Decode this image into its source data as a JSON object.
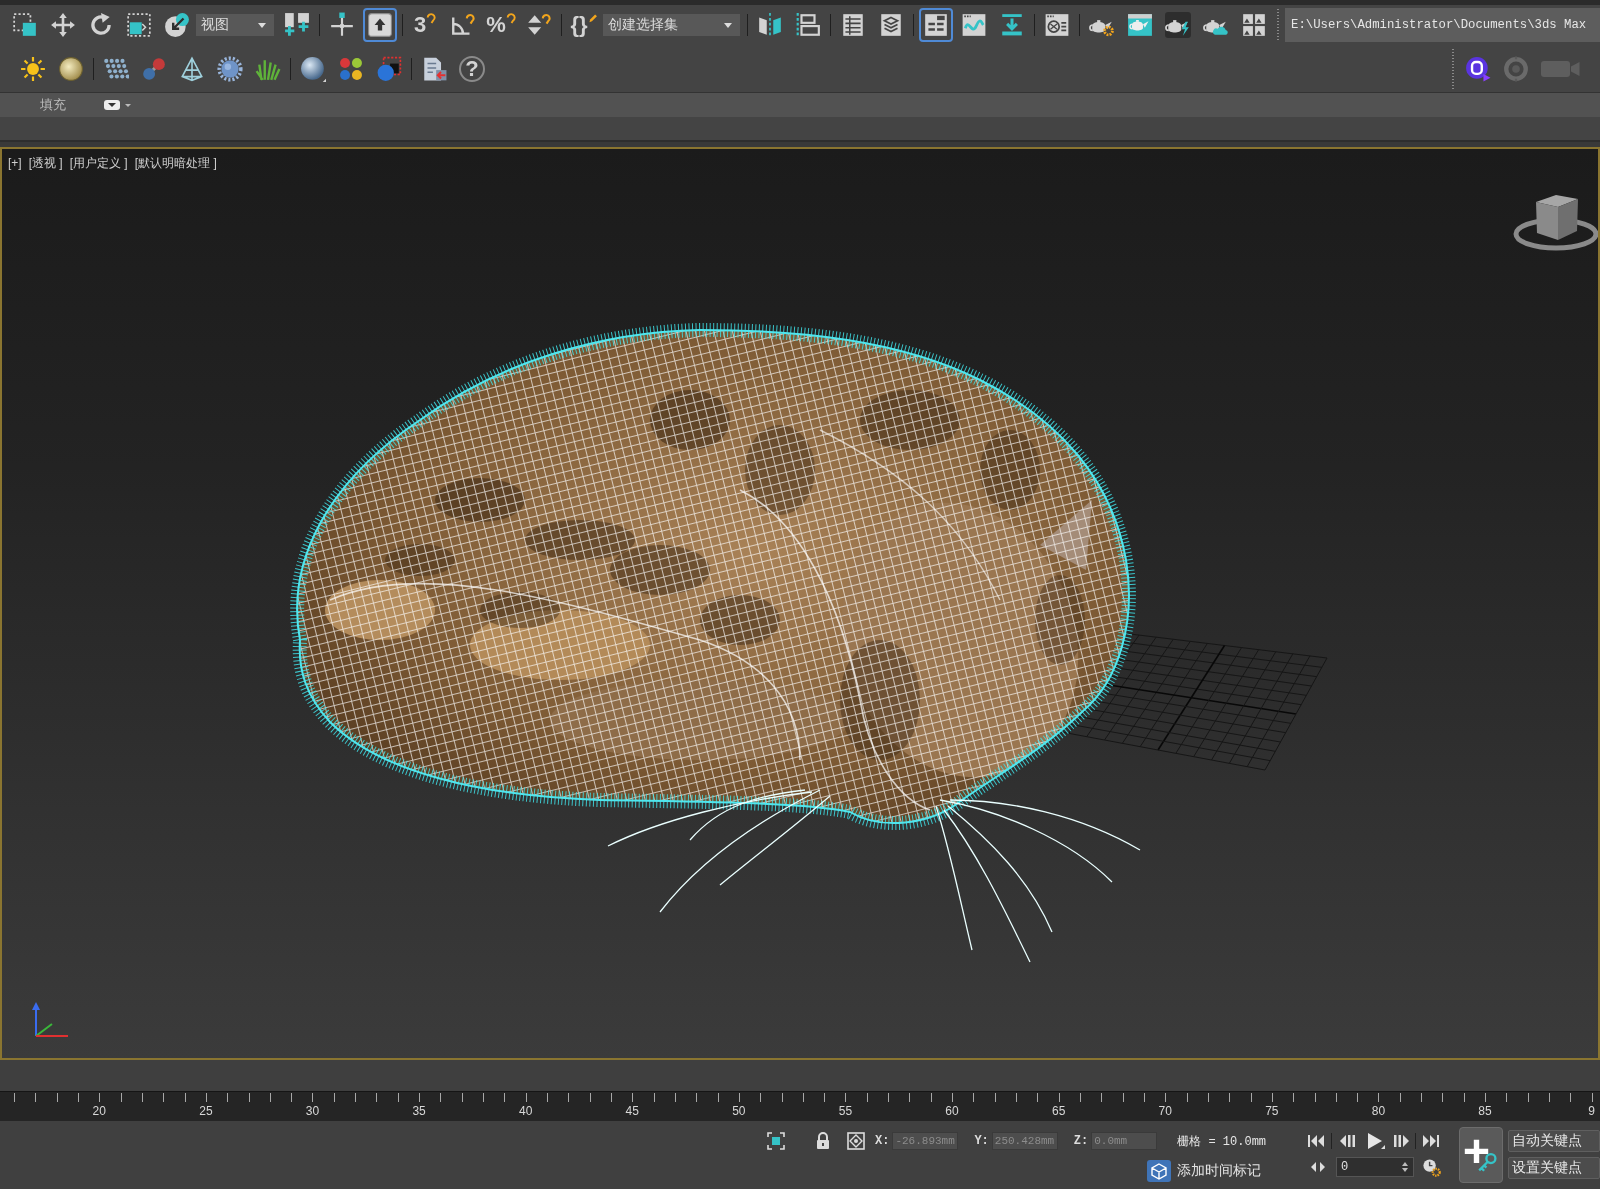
{
  "main_toolbar": {
    "groups": [
      [
        {
          "kind": "button",
          "selected": false
        },
        {
          "kind": "button",
          "selected": false
        },
        {
          "kind": "button",
          "selected": false
        },
        {
          "kind": "button",
          "selected": false
        },
        {
          "kind": "button",
          "selected": false
        },
        {
          "kind": "dropdown",
          "value": "视图"
        },
        {
          "kind": "button",
          "selected": false
        }
      ],
      [
        {
          "kind": "button",
          "selected": false
        },
        {
          "kind": "button",
          "selected": true
        }
      ],
      [
        {
          "kind": "button",
          "selected": false,
          "label": "3"
        },
        {
          "kind": "button",
          "selected": false
        },
        {
          "kind": "button",
          "selected": false,
          "label": "%"
        },
        {
          "kind": "button",
          "selected": false
        }
      ],
      [
        {
          "kind": "button",
          "selected": false,
          "label": "{}"
        },
        {
          "kind": "dropdown",
          "value": "创建选择集"
        }
      ],
      [
        {
          "kind": "button",
          "selected": false
        },
        {
          "kind": "button",
          "selected": false
        }
      ],
      [
        {
          "kind": "button",
          "selected": false
        },
        {
          "kind": "button",
          "selected": false
        }
      ],
      [
        {
          "kind": "button",
          "selected": true
        },
        {
          "kind": "button",
          "selected": false
        },
        {
          "kind": "button",
          "selected": false
        }
      ],
      [
        {
          "kind": "button",
          "selected": false
        }
      ],
      [
        {
          "kind": "button",
          "selected": false
        },
        {
          "kind": "button",
          "selected": false
        },
        {
          "kind": "button",
          "selected": false
        },
        {
          "kind": "button",
          "selected": false
        },
        {
          "kind": "button",
          "selected": false
        }
      ],
      [
        {
          "kind": "field",
          "value": "E:\\Users\\Administrator\\Documents\\3ds Max"
        }
      ]
    ]
  },
  "command_toolbar": {
    "groups": [
      [
        {
          "selected": false
        },
        {
          "selected": false
        }
      ],
      [
        {
          "selected": false
        },
        {
          "selected": false
        },
        {
          "selected": false
        },
        {
          "selected": false
        },
        {
          "selected": false
        }
      ],
      [
        {
          "selected": false
        },
        {
          "selected": false
        },
        {
          "selected": false
        }
      ],
      [
        {
          "selected": false
        },
        {
          "selected": false,
          "label": "?"
        }
      ]
    ],
    "right_buttons": [
      {
        "selected": false
      },
      {
        "selected": false
      },
      {
        "selected": false
      }
    ]
  },
  "ribbon": {
    "tab": "填充"
  },
  "viewport": {
    "labels": [
      "[+]",
      "[透视 ]",
      "[用户定义 ]",
      "[默认明暗处理 ]"
    ]
  },
  "timeline": {
    "frame_labels": [
      "20",
      "25",
      "30",
      "35",
      "40",
      "45",
      "50",
      "55",
      "60",
      "65",
      "70",
      "75",
      "80",
      "85",
      "9"
    ]
  },
  "status_bar": {
    "coordinates": [
      {
        "axis": "X:",
        "value": "-26.893mm",
        "disabled": true
      },
      {
        "axis": "Y:",
        "value": "250.428mm",
        "disabled": true
      },
      {
        "axis": "Z:",
        "value": "0.0mm",
        "disabled": true
      }
    ],
    "grid_spacing": "栅格 = 10.0mm",
    "time_tag": "添加时间标记",
    "frame": "0",
    "auto_key": "自动关键点",
    "set_key": "设置关键点"
  }
}
